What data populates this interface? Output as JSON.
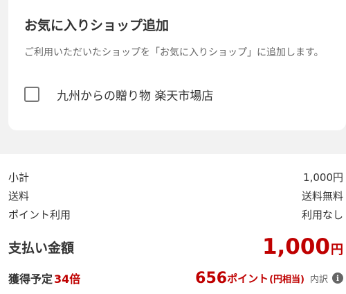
{
  "favorite_shop": {
    "title": "お気に入りショップ追加",
    "description": "ご利用いただいたショップを「お気に入りショップ」に追加します。",
    "shop_name": "九州からの贈り物 楽天市場店",
    "checked": false
  },
  "summary": {
    "subtotal_label": "小計",
    "subtotal_value": "1,000円",
    "shipping_label": "送料",
    "shipping_value": "送料無料",
    "points_use_label": "ポイント利用",
    "points_use_value": "利用なし",
    "total_label": "支払い金額",
    "total_amount": "1,000",
    "total_unit": "円",
    "earn_label": "獲得予定",
    "earn_multiplier": "34倍",
    "earn_points": "656",
    "earn_points_unit": "ポイント",
    "earn_points_note": "(円相当)",
    "breakdown_label": "内訳",
    "info_icon_glyph": "i"
  },
  "colors": {
    "accent": "#bf0000",
    "background": "#f2f2f2",
    "card": "#ffffff",
    "text": "#333333",
    "muted": "#666666"
  }
}
